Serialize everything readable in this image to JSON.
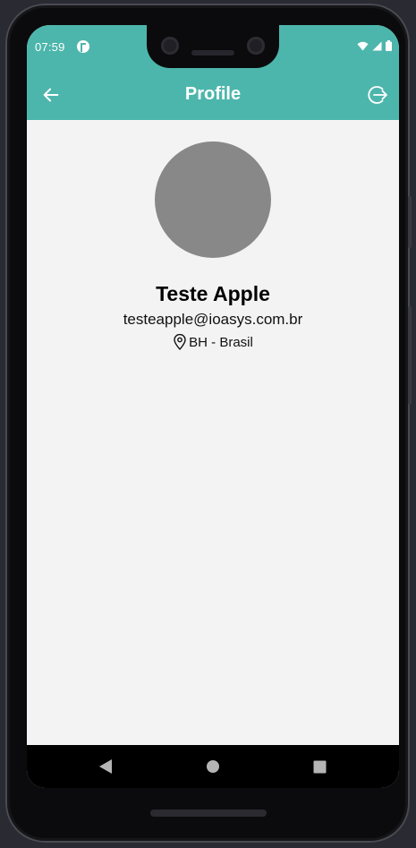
{
  "status_bar": {
    "time": "07:59",
    "icons": [
      "app-notification-icon",
      "wifi-icon",
      "cell-signal-icon",
      "battery-icon"
    ]
  },
  "app_bar": {
    "title": "Profile",
    "back_icon": "arrow-left-icon",
    "logout_icon": "logout-icon",
    "background": "#4db6ac",
    "foreground": "#ffffff"
  },
  "profile": {
    "name": "Teste Apple",
    "email": "testeapple@ioasys.com.br",
    "location": "BH - Brasil",
    "location_icon": "map-pin-icon",
    "avatar_color": "#888888"
  },
  "nav_bar": {
    "icons": [
      "nav-back-icon",
      "nav-home-icon",
      "nav-recents-icon"
    ]
  },
  "colors": {
    "screen_background": "#f3f3f3",
    "text": "#000000"
  }
}
